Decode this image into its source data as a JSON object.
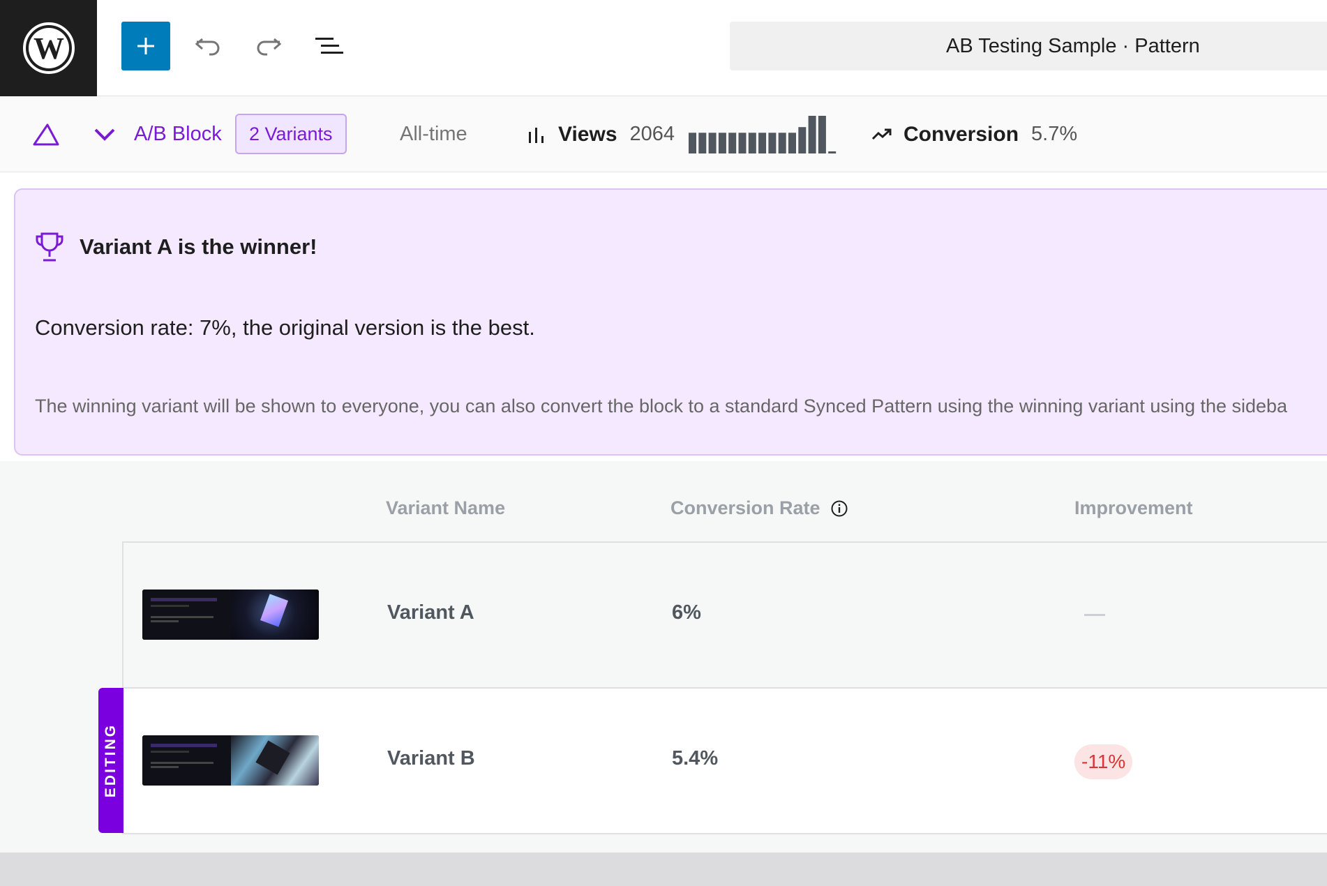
{
  "header": {
    "logo_icon": "wordpress-logo-icon",
    "add_icon": "plus-icon",
    "undo_icon": "undo-icon",
    "redo_icon": "redo-icon",
    "list_view_icon": "list-view-icon",
    "document_title": "AB Testing Sample · Pattern"
  },
  "block_toolbar": {
    "block_icon": "triangle-icon",
    "collapse_icon": "chevron-down-icon",
    "block_name": "A/B Block",
    "variants_label": "2 Variants",
    "period": "All-time",
    "views_icon": "bar-chart-icon",
    "views_label": "Views",
    "views_value": "2064",
    "views_sparkline": [
      0.55,
      0.55,
      0.55,
      0.55,
      0.55,
      0.55,
      0.55,
      0.55,
      0.55,
      0.55,
      0.55,
      0.7,
      1.0,
      1.0,
      0.05
    ],
    "conversion_icon": "trending-up-icon",
    "conversion_label": "Conversion",
    "conversion_value": "5.7%"
  },
  "notice": {
    "icon": "trophy-icon",
    "title": "Variant A is the winner!",
    "rate_text": "Conversion rate: 7%, the original version is the best.",
    "description": "The winning variant will be shown to everyone, you can also convert the block to a standard Synced Pattern using the winning variant using the sideba"
  },
  "table": {
    "headers": {
      "name": "Variant Name",
      "rate": "Conversion Rate",
      "rate_info_icon": "info-icon",
      "improvement": "Improvement"
    },
    "rows": [
      {
        "name": "Variant A",
        "rate": "6%",
        "improvement": ""
      },
      {
        "name": "Variant B",
        "rate": "5.4%",
        "improvement": "-11%"
      }
    ],
    "editing_label": "EDITING"
  },
  "colors": {
    "accent": "#7a00df",
    "wp_blue": "#007cba",
    "notice_bg": "#f5e9ff",
    "negative": "#d63638"
  }
}
